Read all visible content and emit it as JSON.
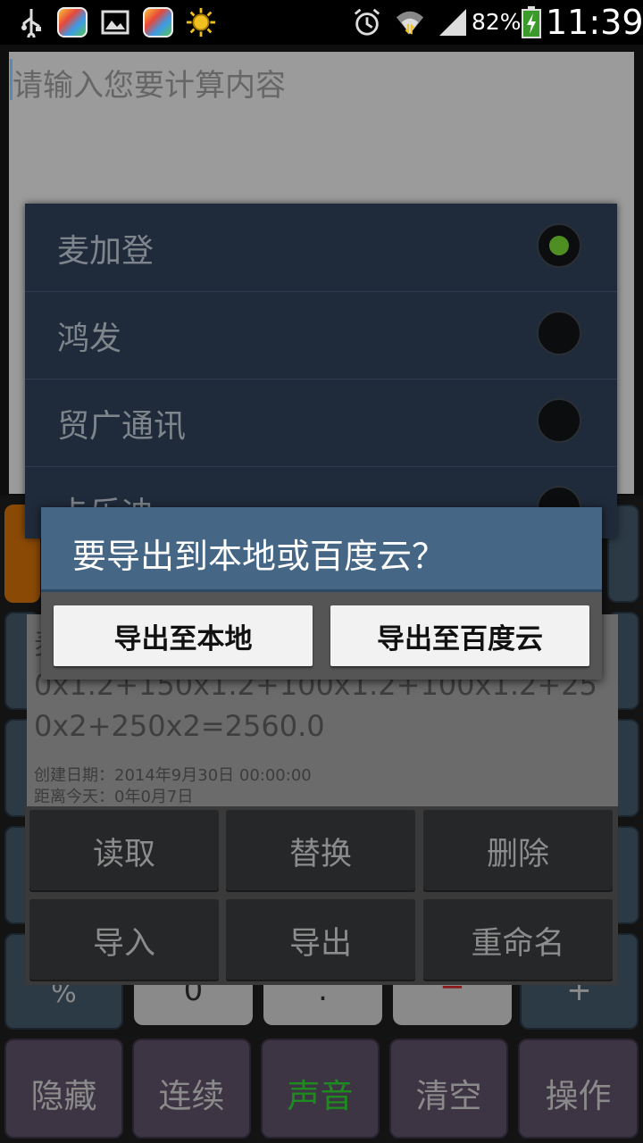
{
  "status_bar": {
    "battery": "82%",
    "time": "11:39",
    "icons": [
      "usb-icon",
      "app-icon",
      "gallery-icon",
      "app-icon",
      "sun-icon",
      "alarm-icon",
      "wifi-icon",
      "signal-icon",
      "battery-icon"
    ]
  },
  "input": {
    "placeholder": "请输入您要计算内容"
  },
  "list_dialog": {
    "items": [
      {
        "label": "麦加登",
        "selected": true
      },
      {
        "label": "鸿发",
        "selected": false
      },
      {
        "label": "贸广通讯",
        "selected": false
      },
      {
        "label": "卡乐迪",
        "selected": false
      }
    ]
  },
  "export_dialog": {
    "title": "要导出到本地或百度云？",
    "local_button": "导出至本地",
    "cloud_button": "导出至百度云"
  },
  "record": {
    "text": "麦加登 [9]月[14]号300x1.6+300x1.6+150x1.2+150x1.2+100x1.2+100x1.2+250x2+250x2=2560.0",
    "created": "创建日期：2014年9月30日 00:00:00",
    "days": "距离今天：0年0月7日"
  },
  "op_buttons": {
    "read": "读取",
    "replace": "替换",
    "delete": "删除",
    "import": "导入",
    "export": "导出",
    "rename": "重命名"
  },
  "keypad_peek": {
    "percent": "%",
    "zero": "0",
    "dot": ".",
    "minus": "−",
    "plus": "+"
  },
  "bottom_bar": {
    "hide": "隐藏",
    "continuous": "连续",
    "sound": "声音",
    "clear": "清空",
    "operate": "操作"
  },
  "colors": {
    "sound_active": "#1f8a1f",
    "radio_selected": "#4f8e22",
    "dialog_header": "#456685"
  }
}
